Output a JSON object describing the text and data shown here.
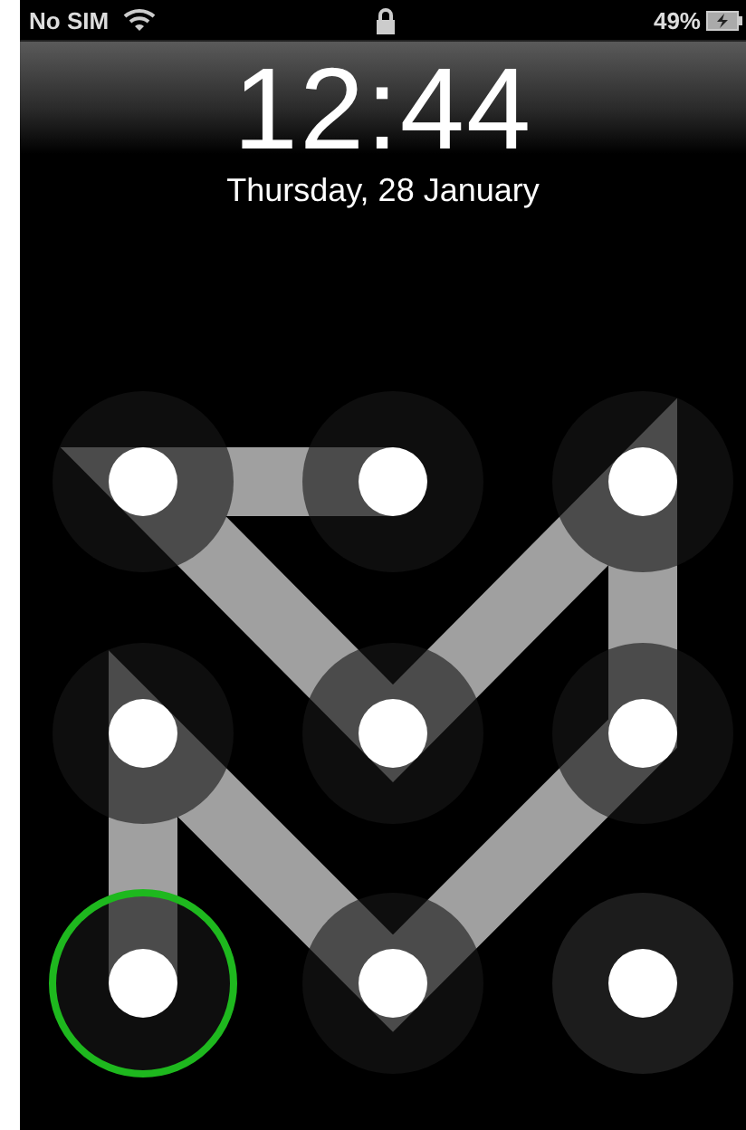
{
  "status_bar": {
    "carrier": "No SIM",
    "battery_percent": "49%",
    "charging": true
  },
  "lock_screen": {
    "time": "12:44",
    "date": "Thursday, 28 January"
  },
  "pattern": {
    "dots": [
      {
        "selected": true,
        "focused": false
      },
      {
        "selected": true,
        "focused": false
      },
      {
        "selected": true,
        "focused": false
      },
      {
        "selected": true,
        "focused": false
      },
      {
        "selected": true,
        "focused": false
      },
      {
        "selected": true,
        "focused": false
      },
      {
        "selected": true,
        "focused": true
      },
      {
        "selected": true,
        "focused": false
      },
      {
        "selected": false,
        "focused": false
      }
    ]
  }
}
